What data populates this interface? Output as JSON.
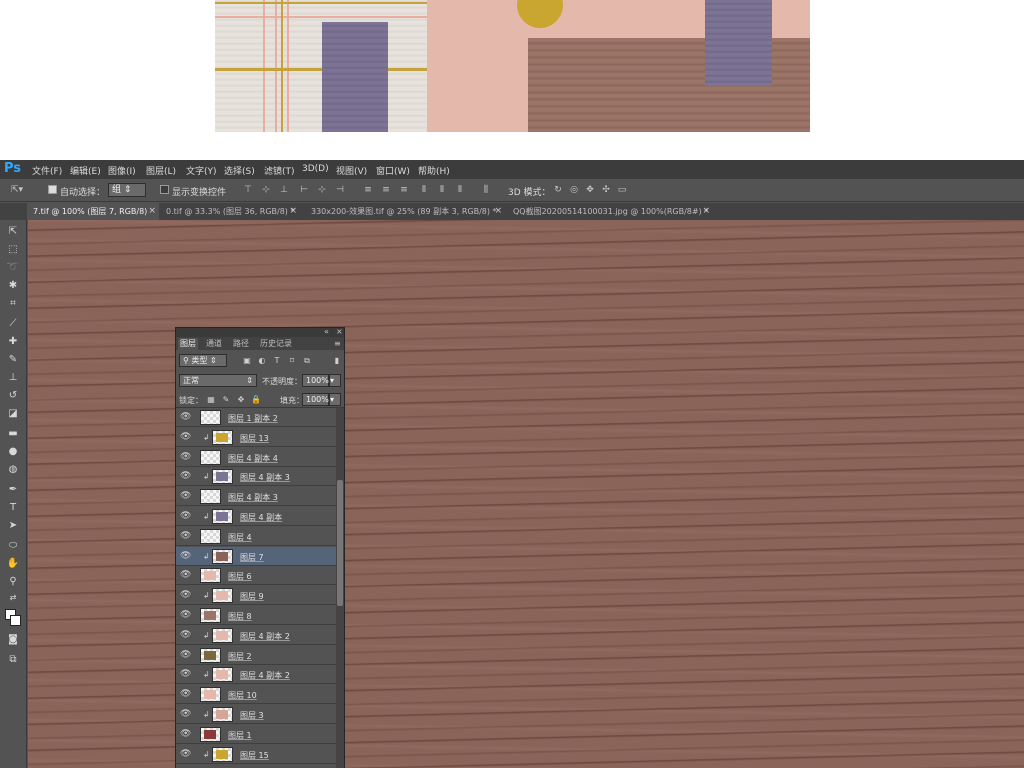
{
  "app": {
    "logo": "Ps",
    "menu": [
      "文件(F)",
      "编辑(E)",
      "图像(I)",
      "图层(L)",
      "文字(Y)",
      "选择(S)",
      "滤镜(T)",
      "3D(D)",
      "视图(V)",
      "窗口(W)",
      "帮助(H)"
    ]
  },
  "options": {
    "auto_select_label": "自动选择：",
    "auto_select_value": "组",
    "show_transform_label": "显示变换控件",
    "mode_3d_label": "3D 模式："
  },
  "tabs": [
    {
      "label": "7.tif @ 100% (图层 7, RGB/8)",
      "close": "×"
    },
    {
      "label": "0.tif @ 33.3% (图层 36, RGB/8) *",
      "close": "×"
    },
    {
      "label": "330x200-效果图.tif @ 25% (89 副本 3, RGB/8) *",
      "close": "×"
    },
    {
      "label": "QQ截图20200514100031.jpg @ 100%(RGB/8#) *",
      "close": "×"
    }
  ],
  "layers_panel": {
    "tabs": [
      "图层",
      "通道",
      "路径",
      "历史记录"
    ],
    "filter_label": "类型",
    "blend_mode": "正常",
    "opacity_label": "不透明度：",
    "opacity_value": "100%",
    "lock_label": "锁定：",
    "fill_label": "填充：",
    "fill_value": "100%",
    "layers": [
      {
        "name": "图层 1 副本 2",
        "clipped": false,
        "selected": false,
        "thumb": "none"
      },
      {
        "name": "图层 13",
        "clipped": true,
        "selected": false,
        "thumb": "#c9a62f"
      },
      {
        "name": "图层 4 副本 4",
        "clipped": false,
        "selected": false,
        "thumb": "none"
      },
      {
        "name": "图层 4 副本 3",
        "clipped": true,
        "selected": false,
        "thumb": "#7d7395"
      },
      {
        "name": "图层 4 副本 3",
        "clipped": false,
        "selected": false,
        "thumb": "none"
      },
      {
        "name": "图层 4 副本",
        "clipped": true,
        "selected": false,
        "thumb": "#7d7395"
      },
      {
        "name": "图层 4",
        "clipped": false,
        "selected": false,
        "thumb": "none"
      },
      {
        "name": "图层 7",
        "clipped": true,
        "selected": true,
        "thumb": "#8a6359"
      },
      {
        "name": "图层 6",
        "clipped": false,
        "selected": false,
        "thumb": "#e4b9ab"
      },
      {
        "name": "图层 9",
        "clipped": true,
        "selected": false,
        "thumb": "#e4b9ab"
      },
      {
        "name": "图层 8",
        "clipped": false,
        "selected": false,
        "thumb": "#9c7468"
      },
      {
        "name": "图层 4 副本 2",
        "clipped": true,
        "selected": false,
        "thumb": "#e4b9ab"
      },
      {
        "name": "图层 2",
        "clipped": false,
        "selected": false,
        "thumb": "#7a6a3a"
      },
      {
        "name": "图层 4 副本 2",
        "clipped": true,
        "selected": false,
        "thumb": "#e4b9ab"
      },
      {
        "name": "图层 10",
        "clipped": false,
        "selected": false,
        "thumb": "#e4b9ab"
      },
      {
        "name": "图层 3",
        "clipped": true,
        "selected": false,
        "thumb": "#d4a598"
      },
      {
        "name": "图层 1",
        "clipped": false,
        "selected": false,
        "thumb": "#8a3a3a"
      },
      {
        "name": "图层 15",
        "clipped": true,
        "selected": false,
        "thumb": "#c9a62f"
      }
    ]
  },
  "colors": {
    "ps_blue": "#31a8ff",
    "canvas_wood": "#8a6359",
    "selected_layer": "#56647a"
  }
}
